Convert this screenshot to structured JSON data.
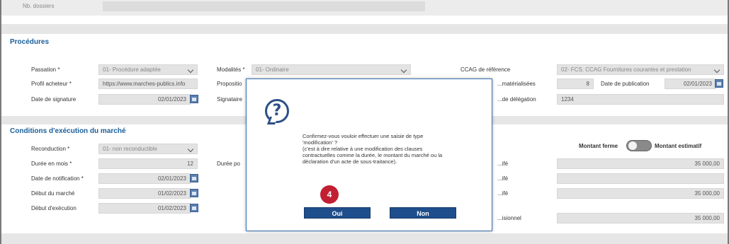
{
  "top": {
    "label": "Nb. dossiers",
    "right_text": ""
  },
  "procedures": {
    "title": "Procédures",
    "passation_label": "Passation *",
    "passation_value": "01- Procédure adaptée",
    "profil_label": "Profil acheteur *",
    "profil_value": "https://www.marches-publics.info",
    "date_signature_label": "Date de signature",
    "date_signature_value": "02/01/2023",
    "modalites_label": "Modalités *",
    "modalites_value": "01- Ordinaire",
    "proposition_label": "Propositio",
    "signataire_label": "Signataire",
    "ccag_label": "CCAG de référence",
    "ccag_value": "02- FCS. CCAG Fournitures courantes et prestation",
    "materialisees_label": "...matérialisées",
    "materialisees_value": "8",
    "date_publication_label": "Date de publication",
    "date_publication_value": "02/01/2023",
    "delegation_label": "...de délégation",
    "delegation_value": "1234"
  },
  "conditions": {
    "title": "Conditions d'exécution du marché",
    "reconduction_label": "Reconduction *",
    "reconduction_value": "01- non reconductible",
    "duree_mois_label": "Durée en mois *",
    "duree_mois_value": "12",
    "date_notification_label": "Date de notification *",
    "date_notification_value": "02/01/2023",
    "debut_marche_label": "Début du marché",
    "debut_marche_value": "01/02/2023",
    "debut_execution_label": "Début d'exécution",
    "debut_execution_value": "01/02/2023",
    "duree_po_label": "Durée po",
    "montant_ferme_label": "Montant ferme",
    "montant_estimatif_label": "Montant estimatif",
    "r1_label": "...ifé",
    "r1_value": "35 000,00",
    "r2_label": "...ifé",
    "r2_value": "",
    "r3_label": "...ifé",
    "r3_value": "35 000,00",
    "r4_label": "...isionnel",
    "r4_value": "35 000,00"
  },
  "modal": {
    "icon": "question-icon",
    "line1": "Confirmez-vous vouloir effectuer une saisie de type",
    "line2": "'modification' ?",
    "line3": "(c'est à dire relative à une modification des clauses",
    "line4": "contractuelles comme la durée, le montant du marché ou la",
    "line5": "déclaration d'un acte de sous-traitance).",
    "step_number": "4",
    "oui_label": "Oui",
    "non_label": "Non"
  },
  "colors": {
    "accent": "#1a5e9a",
    "button": "#1f4e8c",
    "step_badge": "#c21f32"
  }
}
